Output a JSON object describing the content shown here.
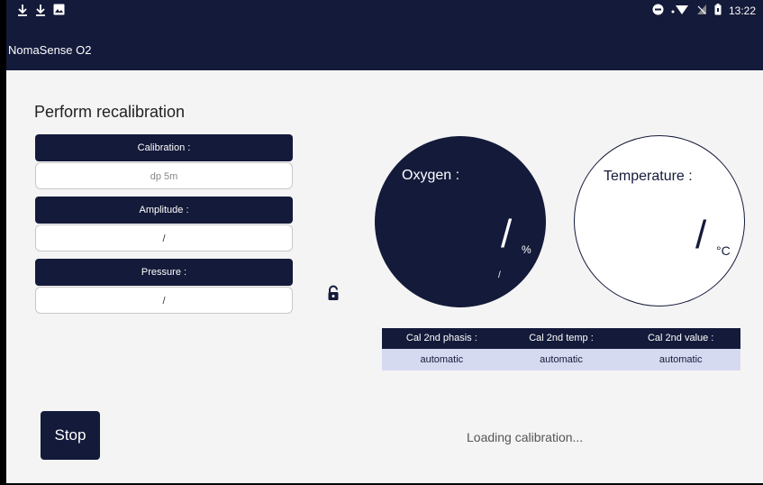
{
  "status_bar": {
    "left_icons": [
      "download-icon",
      "download-icon",
      "image-icon"
    ],
    "right_icons": [
      "do-not-disturb-icon",
      "wifi-icon",
      "no-signal-icon",
      "battery-icon"
    ],
    "time": "13:22"
  },
  "app": {
    "title": "NomaSense O2"
  },
  "page": {
    "heading": "Perform recalibration"
  },
  "fields": {
    "calibration": {
      "label": "Calibration :",
      "value": "dp 5m"
    },
    "amplitude": {
      "label": "Amplitude :",
      "value": "/"
    },
    "pressure": {
      "label": "Pressure :",
      "value": "/"
    }
  },
  "lock": {
    "icon": "lock-icon"
  },
  "gauges": {
    "oxygen": {
      "label": "Oxygen :",
      "value": "/",
      "unit": "%",
      "sub": "/"
    },
    "temperature": {
      "label": "Temperature :",
      "value": "/",
      "unit": "°C"
    }
  },
  "cal_table": {
    "headers": [
      "Cal 2nd phasis :",
      "Cal 2nd temp :",
      "Cal 2nd value :"
    ],
    "values": [
      "automatic",
      "automatic",
      "automatic"
    ]
  },
  "actions": {
    "stop_label": "Stop"
  },
  "status": {
    "message": "Loading calibration..."
  },
  "colors": {
    "primary": "#141a3a",
    "table_row": "#d6daf0",
    "background": "#f4f4f4"
  }
}
